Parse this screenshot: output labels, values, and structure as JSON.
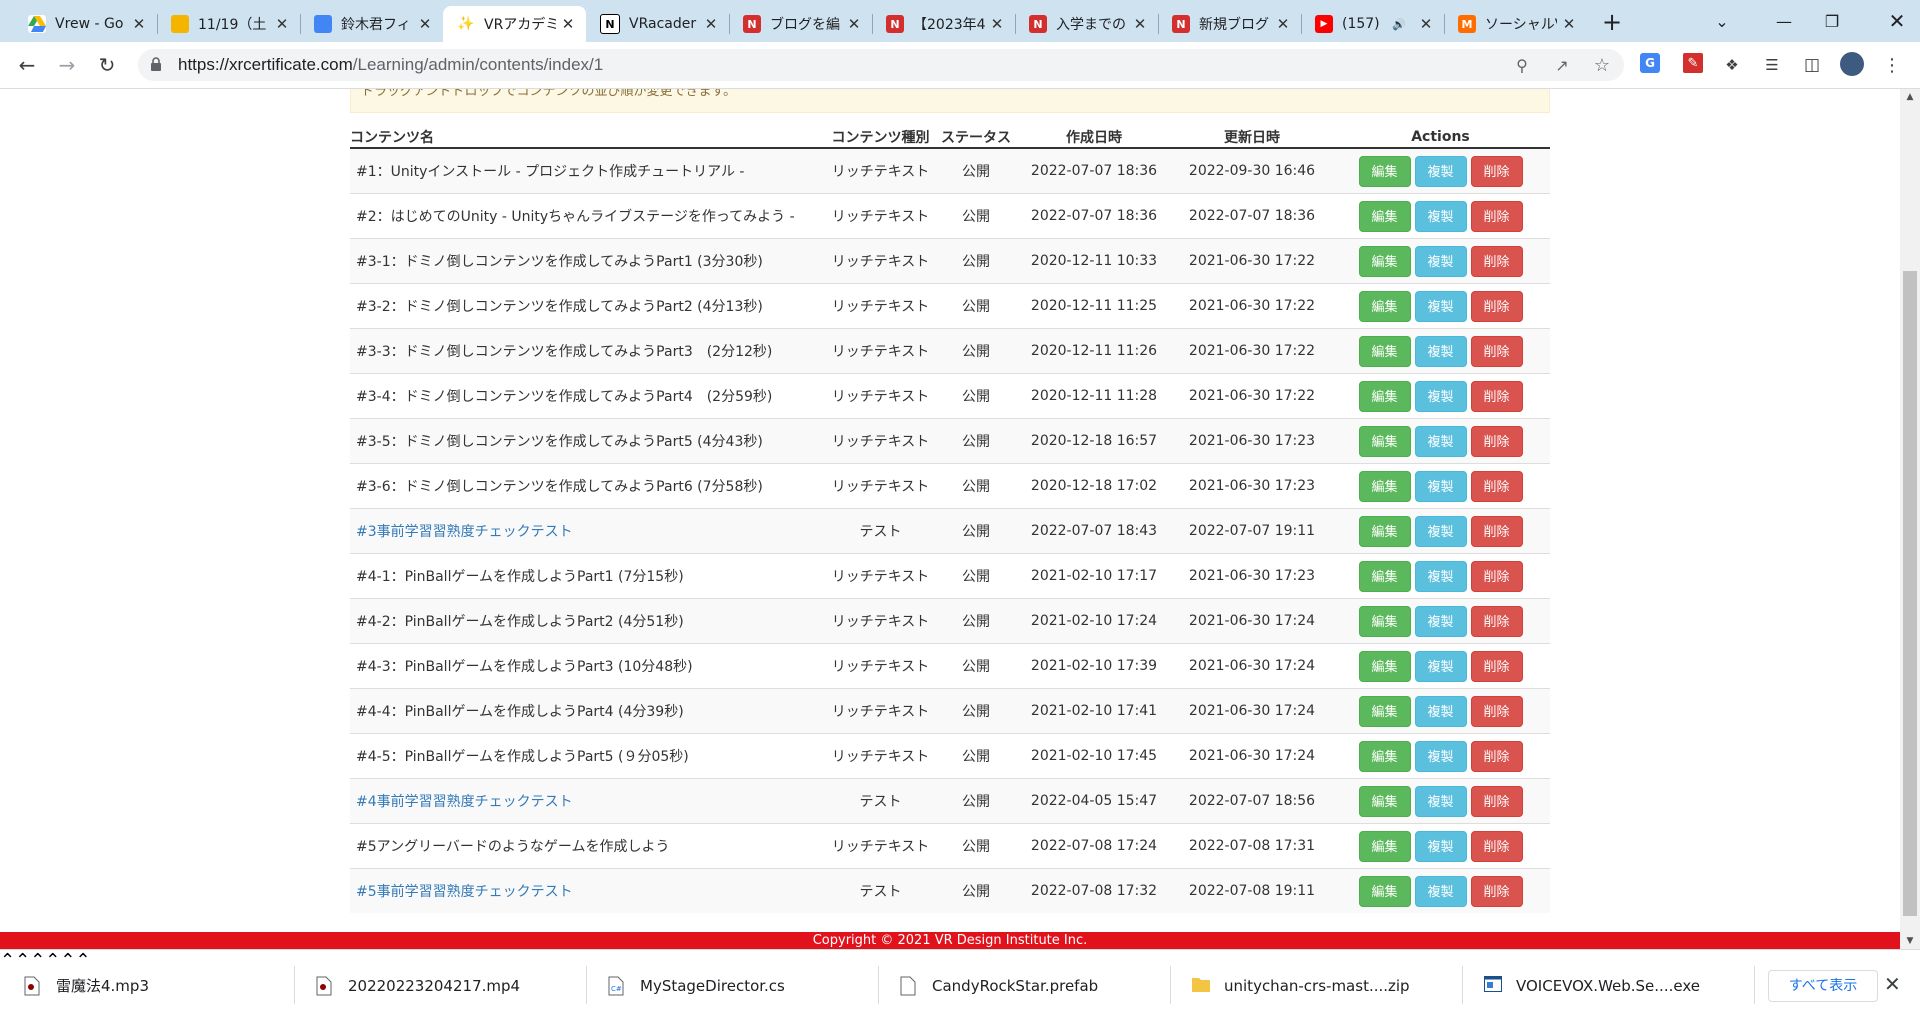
{
  "browser": {
    "tabs": [
      {
        "title": "Vrew - Go",
        "fav": "drive",
        "color": "#ffffff"
      },
      {
        "title": "11/19（土",
        "fav": "slides",
        "color": "#f4b400"
      },
      {
        "title": "鈴木君フィ",
        "fav": "docs",
        "color": "#4285f4"
      },
      {
        "title": "VRアカデミ",
        "fav": "vr",
        "color": "#ffffff"
      },
      {
        "title": "VRacader",
        "fav": "notion",
        "color": "#000000"
      },
      {
        "title": "ブログを編",
        "fav": "red-n",
        "color": "#d32f2f"
      },
      {
        "title": "【2023年4",
        "fav": "red-n",
        "color": "#d32f2f"
      },
      {
        "title": "入学までの",
        "fav": "red-n",
        "color": "#d32f2f"
      },
      {
        "title": "新規ブログ",
        "fav": "red-n",
        "color": "#d32f2f"
      },
      {
        "title": "(157)",
        "fav": "youtube",
        "color": "#ff0000"
      },
      {
        "title": "ソーシャルV",
        "fav": "m",
        "color": "#ff6d00"
      }
    ],
    "url_host": "https://xrcertificate.com",
    "url_path": "/Learning/admin/contents/index/1"
  },
  "notice": "ドラッグアンドドロップでコンテンツの並び順が変更できます。",
  "table": {
    "headers": {
      "name": "コンテンツ名",
      "type": "コンテンツ種別",
      "status": "ステータス",
      "created": "作成日時",
      "updated": "更新日時",
      "actions": "Actions"
    },
    "edit_label": "編集",
    "copy_label": "複製",
    "delete_label": "削除",
    "rows": [
      {
        "name": "#1：Unityインストール - プロジェクト作成チュートリアル -",
        "type": "リッチテキスト",
        "status": "公開",
        "created": "2022-07-07 18:36",
        "updated": "2022-09-30 16:46",
        "link": false
      },
      {
        "name": "#2：はじめてのUnity - Unityちゃんライブステージを作ってみよう -",
        "type": "リッチテキスト",
        "status": "公開",
        "created": "2022-07-07 18:36",
        "updated": "2022-07-07 18:36",
        "link": false
      },
      {
        "name": "#3-1：ドミノ倒しコンテンツを作成してみようPart1 (3分30秒)",
        "type": "リッチテキスト",
        "status": "公開",
        "created": "2020-12-11 10:33",
        "updated": "2021-06-30 17:22",
        "link": false
      },
      {
        "name": "#3-2：ドミノ倒しコンテンツを作成してみようPart2 (4分13秒)",
        "type": "リッチテキスト",
        "status": "公開",
        "created": "2020-12-11 11:25",
        "updated": "2021-06-30 17:22",
        "link": false
      },
      {
        "name": "#3-3：ドミノ倒しコンテンツを作成してみようPart3　(2分12秒)",
        "type": "リッチテキスト",
        "status": "公開",
        "created": "2020-12-11 11:26",
        "updated": "2021-06-30 17:22",
        "link": false
      },
      {
        "name": "#3-4：ドミノ倒しコンテンツを作成してみようPart4　(2分59秒)",
        "type": "リッチテキスト",
        "status": "公開",
        "created": "2020-12-11 11:28",
        "updated": "2021-06-30 17:22",
        "link": false
      },
      {
        "name": "#3-5：ドミノ倒しコンテンツを作成してみようPart5 (4分43秒)",
        "type": "リッチテキスト",
        "status": "公開",
        "created": "2020-12-18 16:57",
        "updated": "2021-06-30 17:23",
        "link": false
      },
      {
        "name": "#3-6：ドミノ倒しコンテンツを作成してみようPart6 (7分58秒)",
        "type": "リッチテキスト",
        "status": "公開",
        "created": "2020-12-18 17:02",
        "updated": "2021-06-30 17:23",
        "link": false
      },
      {
        "name": "#3事前学習習熟度チェックテスト",
        "type": "テスト",
        "status": "公開",
        "created": "2022-07-07 18:43",
        "updated": "2022-07-07 19:11",
        "link": true
      },
      {
        "name": "#4-1：PinBallゲームを作成しようPart1 (7分15秒)",
        "type": "リッチテキスト",
        "status": "公開",
        "created": "2021-02-10 17:17",
        "updated": "2021-06-30 17:23",
        "link": false
      },
      {
        "name": "#4-2：PinBallゲームを作成しようPart2 (4分51秒)",
        "type": "リッチテキスト",
        "status": "公開",
        "created": "2021-02-10 17:24",
        "updated": "2021-06-30 17:24",
        "link": false
      },
      {
        "name": "#4-3：PinBallゲームを作成しようPart3 (10分48秒)",
        "type": "リッチテキスト",
        "status": "公開",
        "created": "2021-02-10 17:39",
        "updated": "2021-06-30 17:24",
        "link": false
      },
      {
        "name": "#4-4：PinBallゲームを作成しようPart4 (4分39秒)",
        "type": "リッチテキスト",
        "status": "公開",
        "created": "2021-02-10 17:41",
        "updated": "2021-06-30 17:24",
        "link": false
      },
      {
        "name": "#4-5：PinBallゲームを作成しようPart5 (９分05秒)",
        "type": "リッチテキスト",
        "status": "公開",
        "created": "2021-02-10 17:45",
        "updated": "2021-06-30 17:24",
        "link": false
      },
      {
        "name": "#4事前学習習熟度チェックテスト",
        "type": "テスト",
        "status": "公開",
        "created": "2022-04-05 15:47",
        "updated": "2022-07-07 18:56",
        "link": true
      },
      {
        "name": "#5アングリーバードのようなゲームを作成しよう",
        "type": "リッチテキスト",
        "status": "公開",
        "created": "2022-07-08 17:24",
        "updated": "2022-07-08 17:31",
        "link": false
      },
      {
        "name": "#5事前学習習熟度チェックテスト",
        "type": "テスト",
        "status": "公開",
        "created": "2022-07-08 17:32",
        "updated": "2022-07-08 19:11",
        "link": true
      }
    ]
  },
  "footer": "Copyright © 2021 VR Design Institute Inc.",
  "downloads": {
    "items": [
      {
        "name": "雷魔法4.mp3",
        "icon": "audio-file-icon"
      },
      {
        "name": "20220223204217.mp4",
        "icon": "video-file-icon"
      },
      {
        "name": "MyStageDirector.cs",
        "icon": "code-file-icon"
      },
      {
        "name": "CandyRockStar.prefab",
        "icon": "file-icon"
      },
      {
        "name": "unitychan-crs-mast....zip",
        "icon": "zip-folder-icon"
      },
      {
        "name": "VOICEVOX.Web.Se....exe",
        "icon": "exe-file-icon"
      }
    ],
    "show_all": "すべて表示"
  }
}
